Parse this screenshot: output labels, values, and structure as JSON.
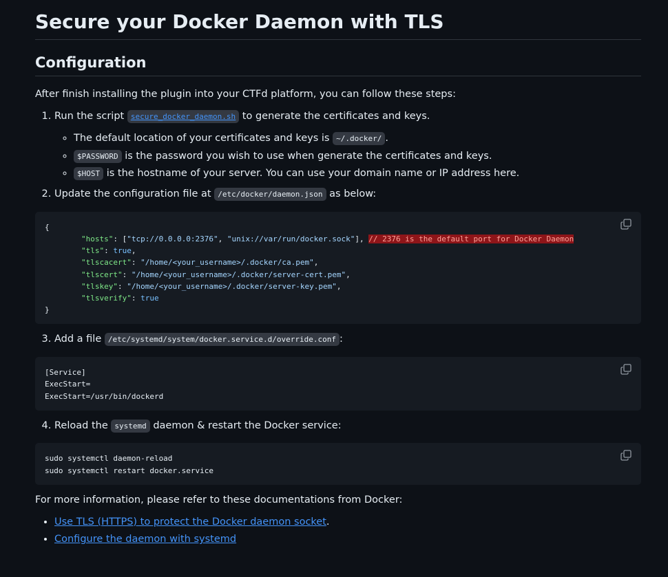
{
  "title": "Secure your Docker Daemon with TLS",
  "section_heading": "Configuration",
  "intro": "After finish installing the plugin into your CTFd platform, you can follow these steps:",
  "steps": [
    {
      "before": "Run the script ",
      "code": "secure_docker_daemon.sh",
      "after": " to generate the certificates and keys.",
      "bullets": [
        {
          "before": "The default location of your certificates and keys is ",
          "code": "~/.docker/",
          "after": "."
        },
        {
          "before": "",
          "code": "$PASSWORD",
          "after": " is the password you wish to use when generate the certificates and keys."
        },
        {
          "before": "",
          "code": "$HOST",
          "after": " is the hostname of your server. You can use your domain name or IP address here."
        }
      ]
    },
    {
      "before": "Update the configuration file at ",
      "code": "/etc/docker/daemon.json",
      "after": " as below:"
    },
    {
      "before": "Add a file ",
      "code": "/etc/systemd/system/docker.service.d/override.conf",
      "after": ":"
    },
    {
      "before": "Reload the ",
      "code": "systemd",
      "after": " daemon & restart the Docker service:"
    }
  ],
  "daemon_json": {
    "open": "{",
    "hosts_key": "\"hosts\"",
    "hosts_val1": "\"tcp://0.0.0.0:2376\"",
    "hosts_val2": "\"unix://var/run/docker.sock\"",
    "hosts_comment": "// 2376 is the default port for Docker Daemon",
    "tls_key": "\"tls\"",
    "tls_val": "true",
    "tlscacert_key": "\"tlscacert\"",
    "tlscacert_val": "\"/home/<your_username>/.docker/ca.pem\"",
    "tlscert_key": "\"tlscert\"",
    "tlscert_val": "\"/home/<your_username>/.docker/server-cert.pem\"",
    "tlskey_key": "\"tlskey\"",
    "tlskey_val": "\"/home/<your_username>/.docker/server-key.pem\"",
    "tlsverify_key": "\"tlsverify\"",
    "tlsverify_val": "true",
    "close": "}"
  },
  "override_conf": "[Service]\nExecStart=\nExecStart=/usr/bin/dockerd",
  "reload_cmds": "sudo systemctl daemon-reload\nsudo systemctl restart docker.service",
  "more_info": "For more information, please refer to these documentations from Docker:",
  "links": [
    {
      "text": "Use TLS (HTTPS) to protect the Docker daemon socket",
      "after": "."
    },
    {
      "text": "Configure the daemon with systemd",
      "after": ""
    }
  ]
}
